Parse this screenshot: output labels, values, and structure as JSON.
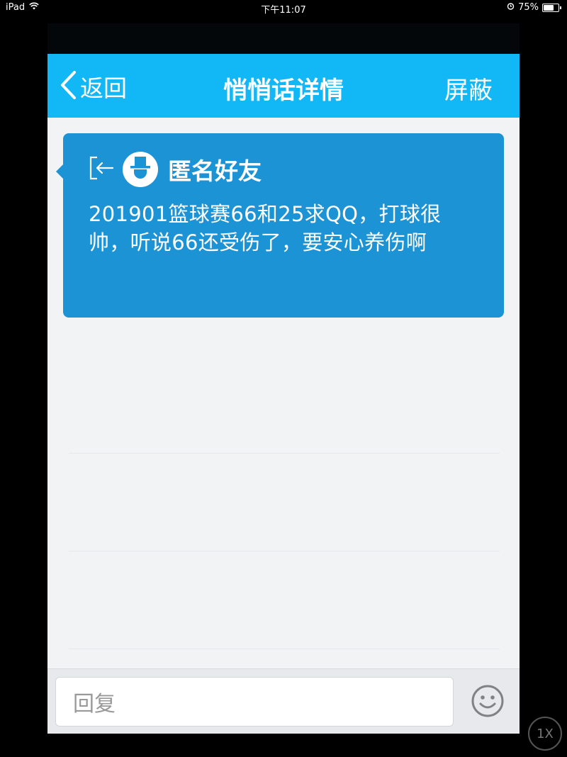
{
  "status_bar": {
    "device": "iPad",
    "time": "下午11:07",
    "battery": "75%",
    "battery_level": 0.75
  },
  "nav": {
    "back_label": "返回",
    "title": "悄悄话详情",
    "right_action": "屏蔽"
  },
  "message": {
    "sender": "匿名好友",
    "text": "201901篮球赛66和25求QQ，打球很帅，听说66还受伤了，要安心养伤啊"
  },
  "input": {
    "placeholder": "回复"
  },
  "overlay": {
    "speed_label": "1X"
  },
  "colors": {
    "nav_bar": "#12b7f5",
    "card": "#1c93d5",
    "background": "#f2f3f5"
  }
}
